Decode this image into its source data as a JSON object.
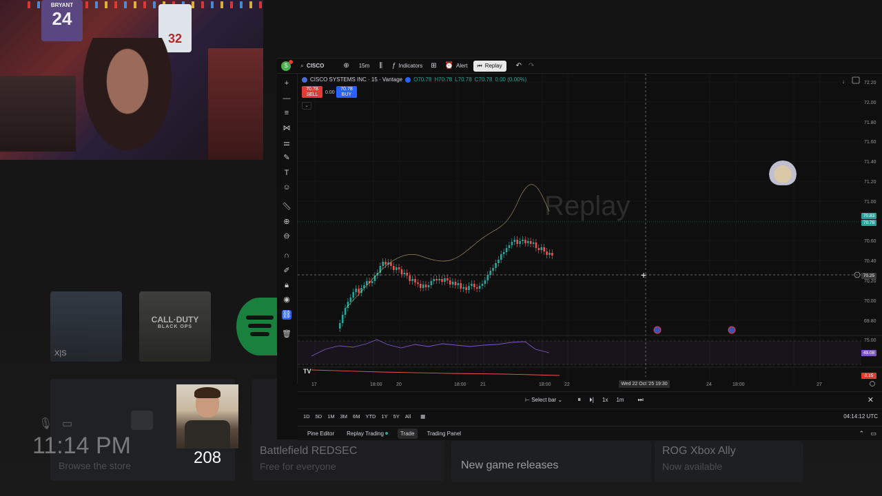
{
  "overlay": {
    "webcam": {
      "jersey_name": "BRYANT",
      "jersey_number": "24",
      "jersey2_number": "32"
    },
    "counter": "208"
  },
  "dashboard": {
    "clock": "11:14 PM",
    "store_label": "Browse the store",
    "battlefield_title": "Battlefield REDSEC",
    "battlefield_sub": "Free for everyone",
    "news_label": "New game releases",
    "rog_title": "ROG Xbox Ally",
    "rog_sub": "Now available",
    "tile_cod_title": "CALL·DUTY",
    "tile_cod_sub": "BLACK OPS",
    "tile_flight_badge": "X|S"
  },
  "tv": {
    "avatar_letter": "S",
    "symbol": "CISCO",
    "interval": "15m",
    "indicators_label": "Indicators",
    "alert_label": "Alert",
    "replay_label": "Replay",
    "legend": {
      "name": "CISCO SYSTEMS INC · 15 · Vantage",
      "o": "O70.78",
      "h": "H70.78",
      "l": "L70.78",
      "c": "C70.78",
      "chg": "0.00 (0.00%)"
    },
    "sell_price": "70.78",
    "sell_label": "SELL",
    "spread": "0.00",
    "buy_price": "70.78",
    "buy_label": "BUY",
    "watermark": "Replay",
    "price_axis": [
      "72.20",
      "72.00",
      "71.80",
      "71.60",
      "71.40",
      "71.20",
      "71.00",
      "70.60",
      "70.40",
      "70.20",
      "70.00",
      "69.80"
    ],
    "price_tag_ask": "70.83",
    "price_tag_last": "70.78",
    "crosshair_price": "70.25",
    "indicator_axis_top": "75.00",
    "indicator_axis_val": "49.08",
    "macd_val": "0.15",
    "time_axis": [
      "17",
      "18:00",
      "20",
      "18:00",
      "21",
      "18:00",
      "22",
      "18:00",
      "24",
      "18:00",
      "27"
    ],
    "crosshair_time": "Wed 22 Oct '25   19:30",
    "replay_bar": {
      "select_bar": "Select bar",
      "speed": "1x",
      "interval": "1m"
    },
    "ranges": [
      "1D",
      "5D",
      "1M",
      "3M",
      "6M",
      "YTD",
      "1Y",
      "5Y",
      "All"
    ],
    "utc_time": "04:14:12 UTC",
    "bottom_tabs": [
      "Pine Editor",
      "Replay Trading",
      "Trade",
      "Trading Panel"
    ],
    "logo": "TV"
  }
}
